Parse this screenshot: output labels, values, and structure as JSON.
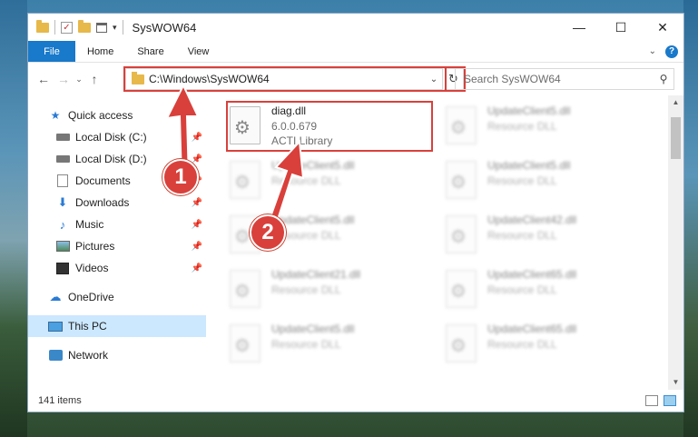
{
  "window": {
    "title": "SysWOW64"
  },
  "ribbon": {
    "tabs": [
      "File",
      "Home",
      "Share",
      "View"
    ]
  },
  "address": {
    "path": "C:\\Windows\\SysWOW64"
  },
  "search": {
    "placeholder": "Search SysWOW64"
  },
  "sidebar": {
    "items": [
      {
        "label": "Quick access",
        "icon": "star-icon"
      },
      {
        "label": "Local Disk (C:)",
        "icon": "drive-icon"
      },
      {
        "label": "Local Disk (D:)",
        "icon": "drive-icon"
      },
      {
        "label": "Documents",
        "icon": "documents-icon"
      },
      {
        "label": "Downloads",
        "icon": "download-icon"
      },
      {
        "label": "Music",
        "icon": "music-icon"
      },
      {
        "label": "Pictures",
        "icon": "pictures-icon"
      },
      {
        "label": "Videos",
        "icon": "videos-icon"
      },
      {
        "label": "OneDrive",
        "icon": "cloud-icon"
      },
      {
        "label": "This PC",
        "icon": "computer-icon"
      },
      {
        "label": "Network",
        "icon": "network-icon"
      }
    ]
  },
  "files": [
    {
      "name": "diag.dll",
      "meta1": "6.0.0.679",
      "meta2": "ACTI Library"
    },
    {
      "name": "UpdateClient5.dll",
      "meta1": "Resource DLL"
    },
    {
      "name": "UpdateClient5.dll",
      "meta1": "Resource DLL"
    },
    {
      "name": "UpdateClient5.dll",
      "meta1": "Resource DLL"
    },
    {
      "name": "UpdateClient5.dll",
      "meta1": "Resource DLL"
    },
    {
      "name": "UpdateClient42.dll",
      "meta1": "Resource DLL"
    },
    {
      "name": "UpdateClient21.dll",
      "meta1": "Resource DLL"
    },
    {
      "name": "UpdateClient65.dll",
      "meta1": "Resource DLL"
    },
    {
      "name": "UpdateClient5.dll",
      "meta1": "Resource DLL"
    },
    {
      "name": "UpdateClient65.dll",
      "meta1": "Resource DLL"
    }
  ],
  "status": {
    "count": "141 items"
  },
  "callouts": [
    "1",
    "2"
  ],
  "colors": {
    "accent": "#1979ca",
    "highlight": "#d9403b"
  }
}
